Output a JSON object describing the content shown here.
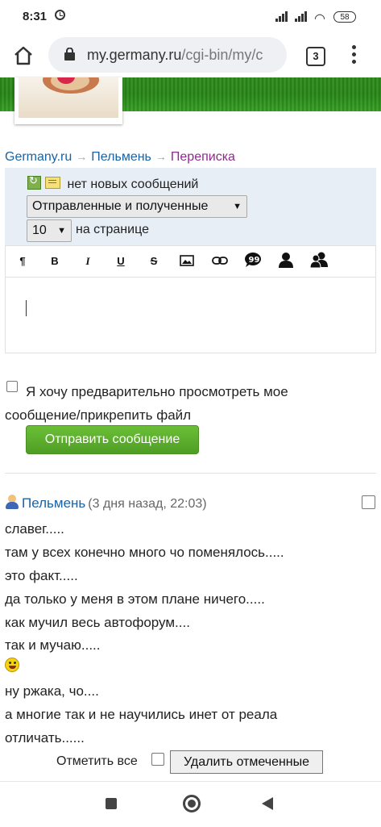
{
  "status_bar": {
    "time": "8:31",
    "battery": "58"
  },
  "browser": {
    "url_host": "my.germany.ru",
    "url_path": "/cgi-bin/my/c",
    "tab_count": "3"
  },
  "breadcrumb": {
    "items": [
      "Germany.ru",
      "Пельмень",
      "Переписка"
    ],
    "separator": "→"
  },
  "panel": {
    "status_text": "нет новых сообщений",
    "filter_select": "Отправленные и полученные",
    "per_page_select": "10",
    "per_page_label": "на странице"
  },
  "toolbar": {
    "paragraph": "¶",
    "bold": "B",
    "italic": "I",
    "underline": "U",
    "strike": "S",
    "icons": [
      "paragraph-icon",
      "bold-icon",
      "italic-icon",
      "underline-icon",
      "strikethrough-icon",
      "image-icon",
      "link-icon",
      "quote-icon",
      "user-icon",
      "users-icon"
    ]
  },
  "compose": {
    "preview_label": "Я хочу предварительно просмотреть мое сообщение/прикрепить файл",
    "send_label": "Отправить сообщение"
  },
  "message": {
    "author": "Пельмень",
    "time": "(3 дня назад, 22:03)",
    "lines": [
      "славег.....",
      "там у всех конечно много чо поменялось.....",
      "это факт.....",
      "да только у меня в этом плане ничего.....",
      "как мучил весь автофорум....",
      "так и мучаю.....",
      "ну ржака, чо....",
      "а многие так и не научились инет от реала",
      "отличать......"
    ]
  },
  "actions": {
    "mark_all_label": "Отметить все",
    "delete_label": "Удалить отмеченные"
  },
  "colors": {
    "link": "#1b63a5",
    "current_link": "#8e2a8e",
    "send_button": "#5aae2c",
    "panel_bg": "#e8eef6"
  }
}
